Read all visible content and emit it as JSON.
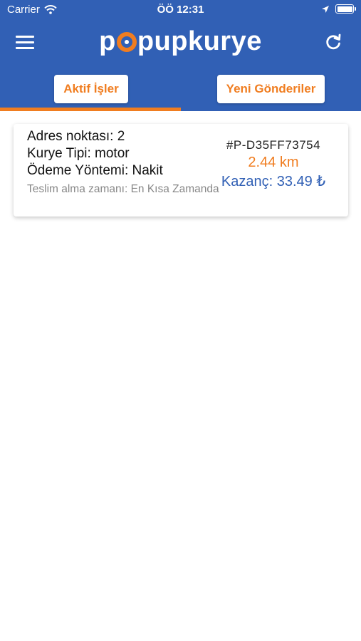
{
  "status_bar": {
    "carrier": "Carrier",
    "time": "ÖÖ 12:31"
  },
  "header": {
    "logo_prefix": "p",
    "logo_suffix": "pupkurye",
    "tabs": [
      {
        "label": "Aktif İşler",
        "active": true
      },
      {
        "label": "Yeni Gönderiler",
        "active": false
      }
    ]
  },
  "colors": {
    "primary": "#3160b5",
    "accent": "#f07d20"
  },
  "orders": [
    {
      "address_points": "Adres noktası: 2",
      "courier_type": "Kurye Tipi: motor",
      "payment_method": "Ödeme Yöntemi: Nakit",
      "pickup_time": "Teslim alma zamanı: En Kısa Zamanda",
      "order_id": "#P-D35FF73754",
      "distance": "2.44 km",
      "earning": "Kazanç: 33.49 ₺"
    }
  ]
}
